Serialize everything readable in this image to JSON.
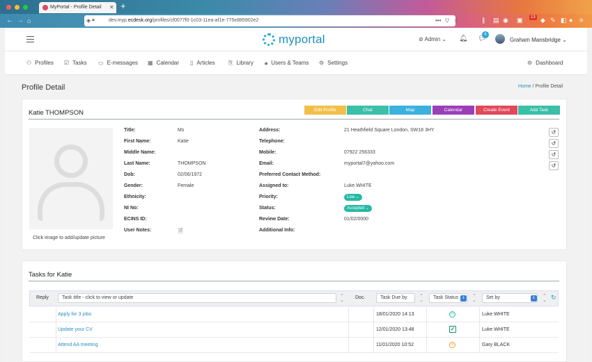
{
  "browser": {
    "tab_title": "MyPortal - Profile Detail",
    "url_host": "dev.myp.ecdesk.org",
    "url_path": "/profiles/cf0077f0-1c03-11ea-af1e-775e885902e2",
    "url_prefix": "dev.myp.",
    "url_domain": "ecdesk.org",
    "notification_count": "13"
  },
  "header": {
    "logo": "myportal",
    "admin_label": "Admin",
    "chat_badge": "6",
    "user_name": "Graham Mansbridge"
  },
  "nav": {
    "profiles": "Profiles",
    "tasks": "Tasks",
    "emessages": "E-messages",
    "calendar": "Calendar",
    "articles": "Articles",
    "library": "Library",
    "users_teams": "Users & Teams",
    "settings": "Settings",
    "dashboard": "Dashboard"
  },
  "page": {
    "title": "Profile Detail",
    "crumb_home": "Home",
    "crumb_sep": "/",
    "crumb_current": "Profile Detail"
  },
  "profile": {
    "name": "Katie THOMPSON",
    "actions": {
      "edit": "Edit Profile",
      "chat": "Chat",
      "map": "Map",
      "calendar": "Calendar",
      "create_event": "Create Event",
      "add_task": "Add Task"
    },
    "photo_caption": "Click image to add/update picture",
    "left_fields": [
      {
        "label": "Title:",
        "value": "Ms"
      },
      {
        "label": "First Name:",
        "value": "Katie"
      },
      {
        "label": "Middle Name:",
        "value": ""
      },
      {
        "label": "Last Name:",
        "value": "THOMPSON"
      },
      {
        "label": "Dob:",
        "value": "02/06/1972"
      },
      {
        "label": "Gender:",
        "value": "Female"
      },
      {
        "label": "Ethnicity:",
        "value": ""
      },
      {
        "label": "NI No:",
        "value": ""
      },
      {
        "label": "ECINS ID:",
        "value": ""
      },
      {
        "label": "User Notes:",
        "value": ""
      }
    ],
    "right_fields": [
      {
        "label": "Address:",
        "value": "21 Heathfield Square London, SW18 3HY"
      },
      {
        "label": "Telephone:",
        "value": ""
      },
      {
        "label": "Mobile:",
        "value": "07922 256333"
      },
      {
        "label": "Email:",
        "value": "myportal7@yahoo.com"
      },
      {
        "label": "Preferred Contact Method:",
        "value": ""
      },
      {
        "label": "Assigned to:",
        "value": "Luke WHITE"
      },
      {
        "label": "Priority:",
        "value": "Low"
      },
      {
        "label": "Status:",
        "value": "Accepted"
      },
      {
        "label": "Review Date:",
        "value": "01/02/0000"
      },
      {
        "label": "Additional Info:",
        "value": ""
      }
    ]
  },
  "tasks": {
    "title": "Tasks for Katie",
    "headers": {
      "reply": "Reply",
      "task_title_placeholder": "Task title - click to view or update",
      "doc": "Doc.",
      "due_by": "Task Due by",
      "status": "Task Status",
      "set_by": "Set by"
    },
    "rows": [
      {
        "title": "Apply for 3 jobs",
        "due": "18/01/2020 14:13",
        "status_icon": "clock-icon",
        "set_by": "Luke WHITE"
      },
      {
        "title": "Update your CV",
        "due": "12/01/2020 13:48",
        "status_icon": "check-icon",
        "set_by": "Luke WHITE"
      },
      {
        "title": "Attend AA meeting",
        "due": "11/01/2020 10:52",
        "status_icon": "clock-icon",
        "set_by": "Gary BLACK"
      }
    ]
  },
  "colors": {
    "edit": "#f2c04a",
    "chat": "#3bbfa7",
    "map": "#3bb1de",
    "calendar": "#9b3fb8",
    "create_event": "#e04a5a",
    "add_task": "#3bbfa7",
    "link": "#2a8fc0"
  }
}
